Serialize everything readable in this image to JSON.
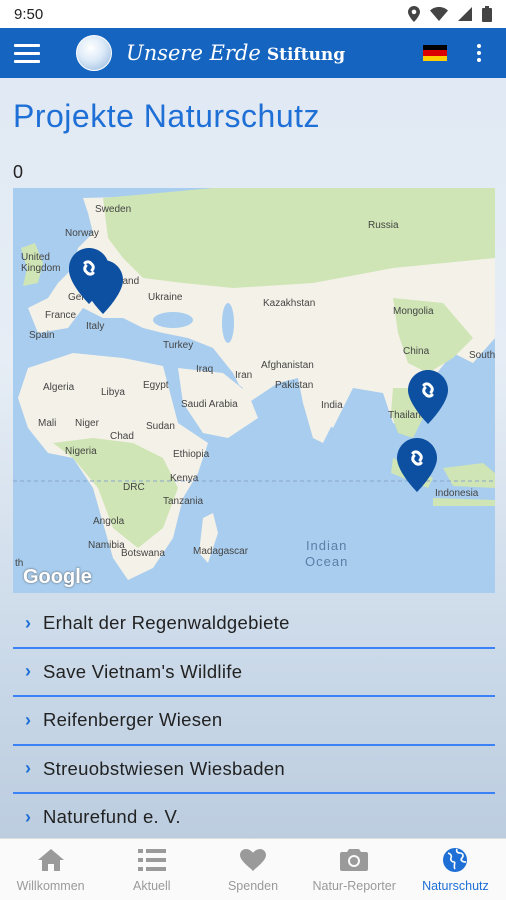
{
  "status_bar": {
    "time": "9:50"
  },
  "app_bar": {
    "brand_script": "Unsere Erde",
    "brand_bold": "Stiftung",
    "flag_colors": [
      "#000000",
      "#dd0000",
      "#ffce00"
    ]
  },
  "page": {
    "title": "Projekte Naturschutz",
    "counter": "0"
  },
  "map": {
    "attribution": "Google",
    "country_labels": [
      "Sweden",
      "Norway",
      "United Kingdom",
      "Germany",
      "Poland",
      "Ukraine",
      "France",
      "Italy",
      "Spain",
      "Turkey",
      "Russia",
      "Kazakhstan",
      "Mongolia",
      "China",
      "South",
      "Afghanistan",
      "Iraq",
      "Iran",
      "Pakistan",
      "India",
      "Thailand",
      "Indonesia",
      "Algeria",
      "Libya",
      "Egypt",
      "Saudi Arabia",
      "Mali",
      "Niger",
      "Chad",
      "Sudan",
      "Nigeria",
      "Ethiopia",
      "Kenya",
      "DRC",
      "Tanzania",
      "Angola",
      "Namibia",
      "Botswana",
      "Madagascar",
      "th"
    ],
    "ocean_labels": [
      "Indian",
      "Ocean"
    ],
    "markers": [
      "europe-marker-1",
      "europe-marker-2",
      "vietnam-marker",
      "sumatra-marker"
    ],
    "colors": {
      "water": "#a8cdee",
      "land": "#f4f1e8",
      "green": "#cfe5b5",
      "marker": "#0d4fa0"
    }
  },
  "projects": [
    "Erhalt der Regenwaldgebiete",
    "Save Vietnam's Wildlife",
    "Reifenberger Wiesen",
    "Streuobstwiesen Wiesbaden",
    "Naturefund e. V."
  ],
  "nav": [
    {
      "label": "Willkommen",
      "icon": "home-icon",
      "active": false
    },
    {
      "label": "Aktuell",
      "icon": "list-icon",
      "active": false
    },
    {
      "label": "Spenden",
      "icon": "heart-icon",
      "active": false
    },
    {
      "label": "Natur-Reporter",
      "icon": "camera-icon",
      "active": false
    },
    {
      "label": "Naturschutz",
      "icon": "globe-icon",
      "active": true
    }
  ]
}
